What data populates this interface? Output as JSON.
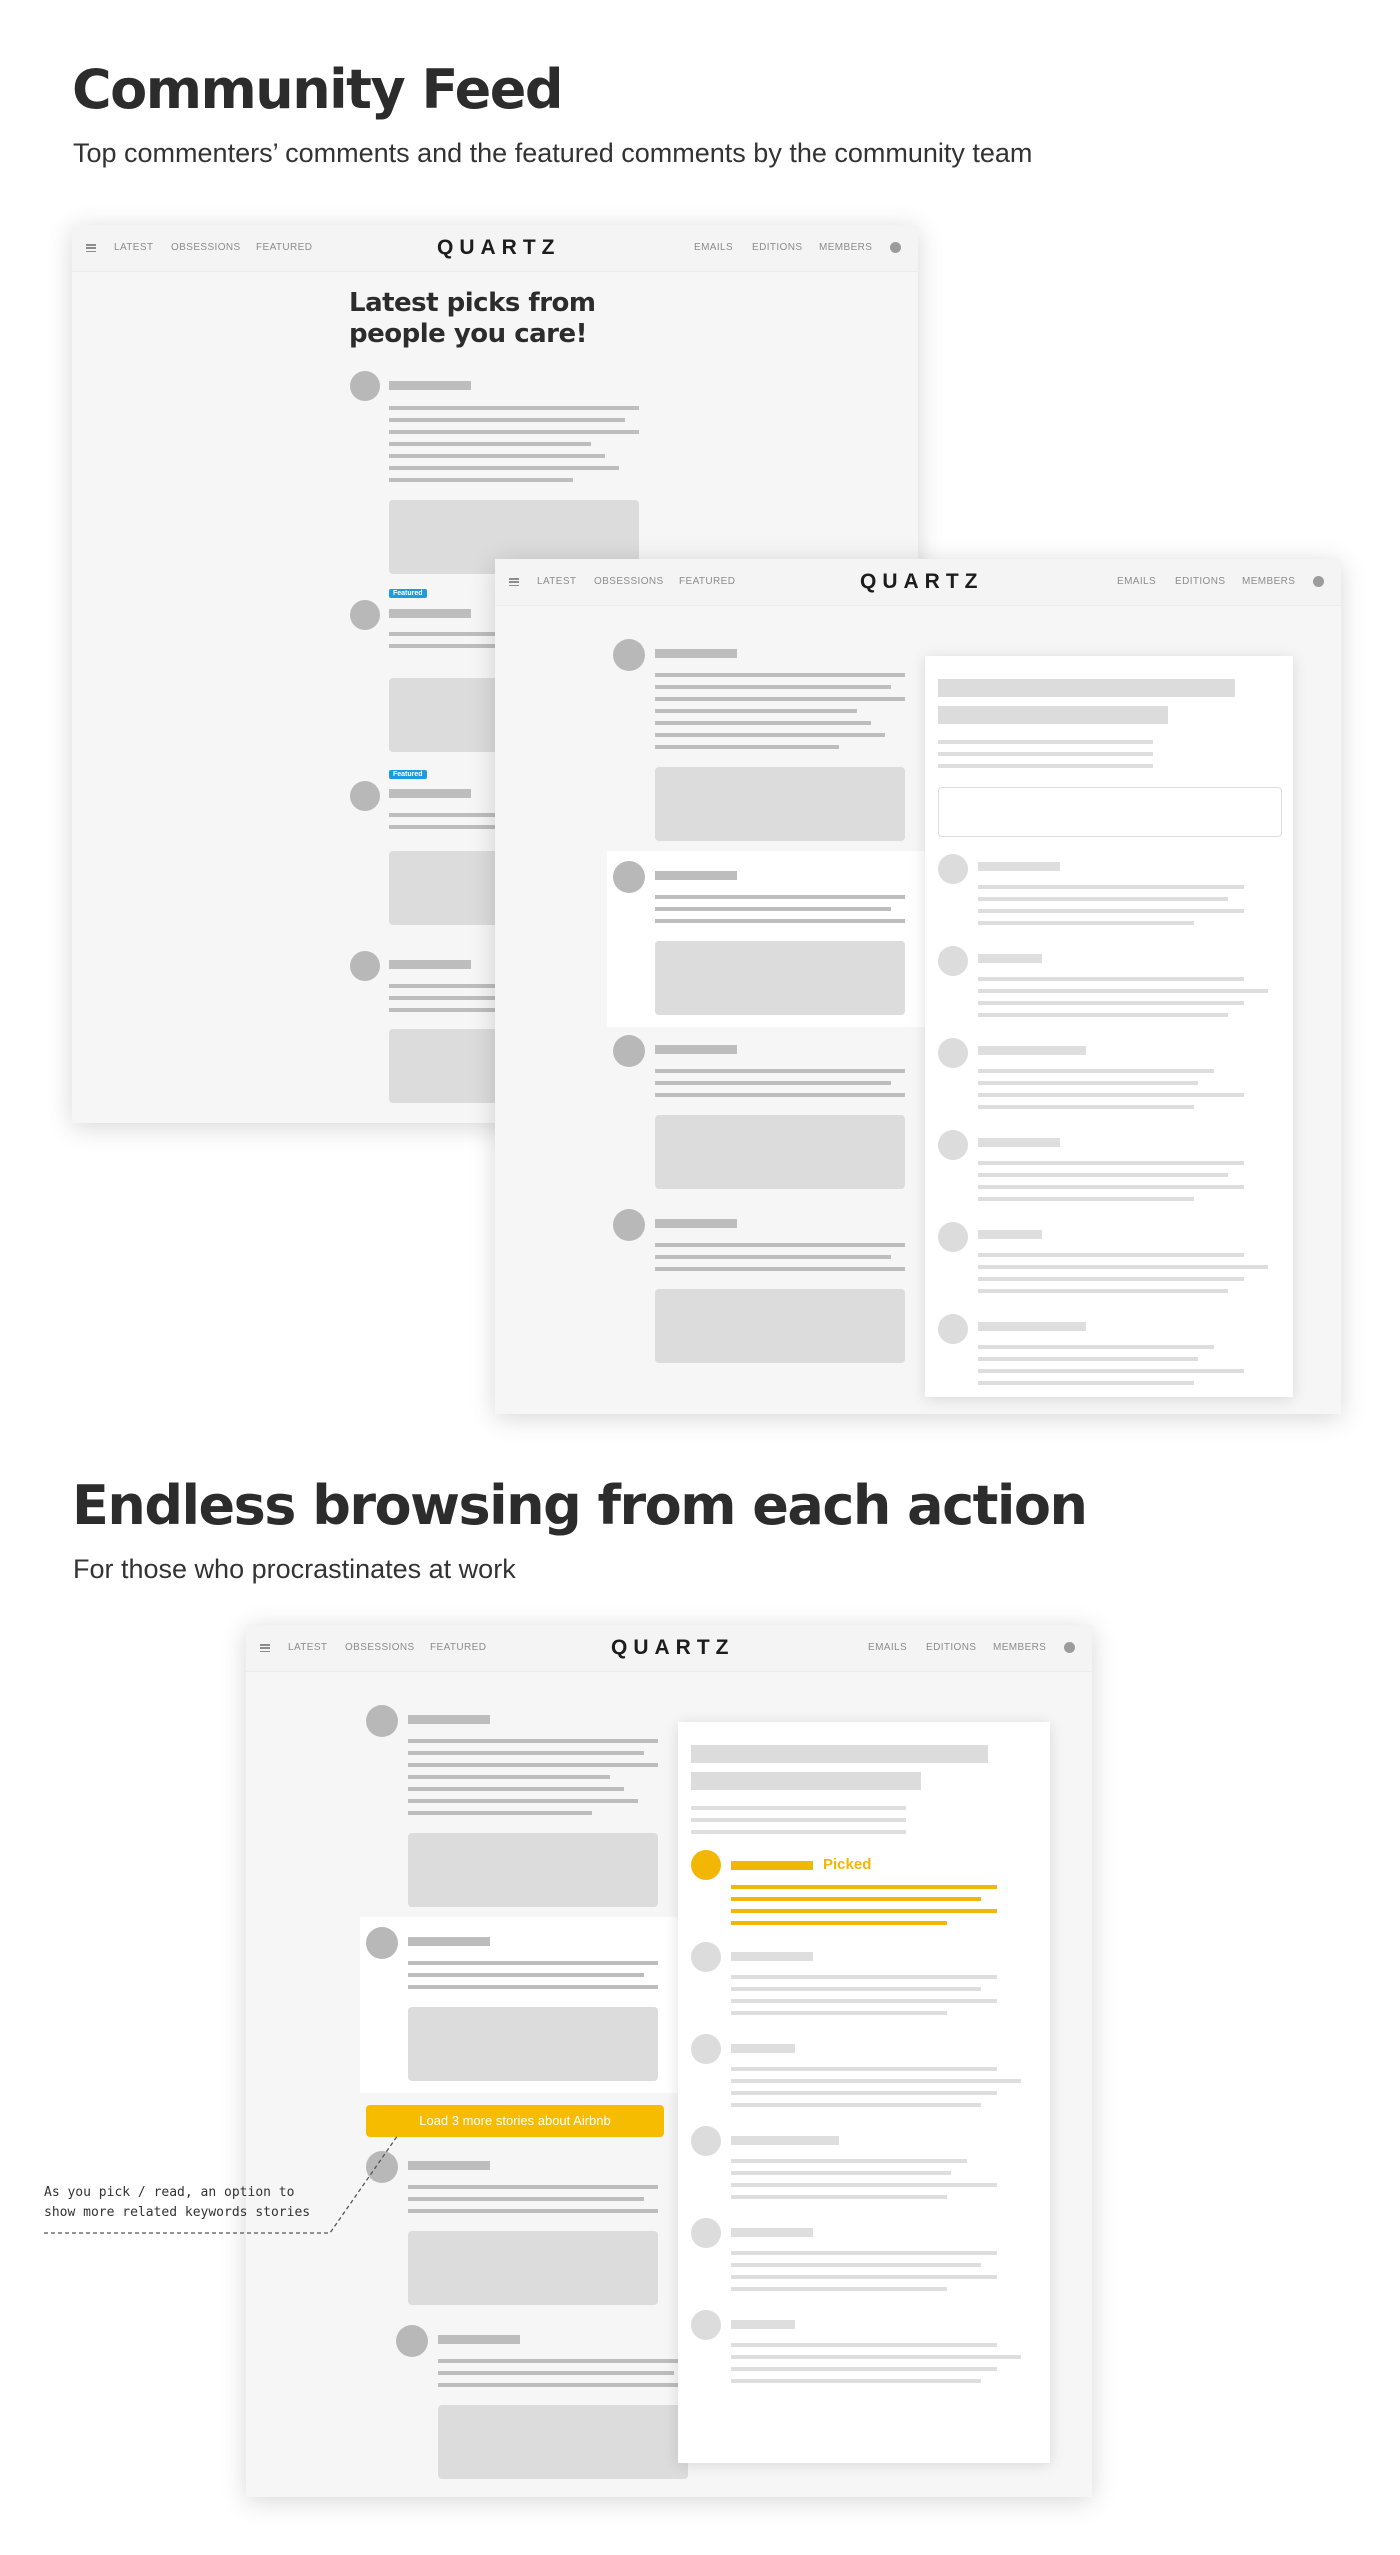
{
  "section1": {
    "title": "Community Feed",
    "subtitle": "Top commenters’ comments and the featured comments by the community team"
  },
  "section2": {
    "title": "Endless browsing from each action",
    "subtitle": "For those who procrastinates at work"
  },
  "nav": {
    "left": [
      "LATEST",
      "OBSESSIONS",
      "FEATURED"
    ],
    "logo": "QUARTZ",
    "right": [
      "EMAILS",
      "EDITIONS",
      "MEMBERS"
    ],
    "menu_icon": "hamburger-menu-icon",
    "user_icon": "user-avatar-icon"
  },
  "feed": {
    "heading": "Latest picks from people you care!",
    "badge": "Featured"
  },
  "browse": {
    "picked_label": "Picked",
    "load_more": "Load 3 more stories about Airbnb",
    "annotation": "As you pick / read, an option to\nshow more related keywords stories"
  },
  "colors": {
    "accent_yellow": "#f2b705",
    "featured_blue": "#1e9be0",
    "placeholder_gray": "#dcdcdc"
  }
}
